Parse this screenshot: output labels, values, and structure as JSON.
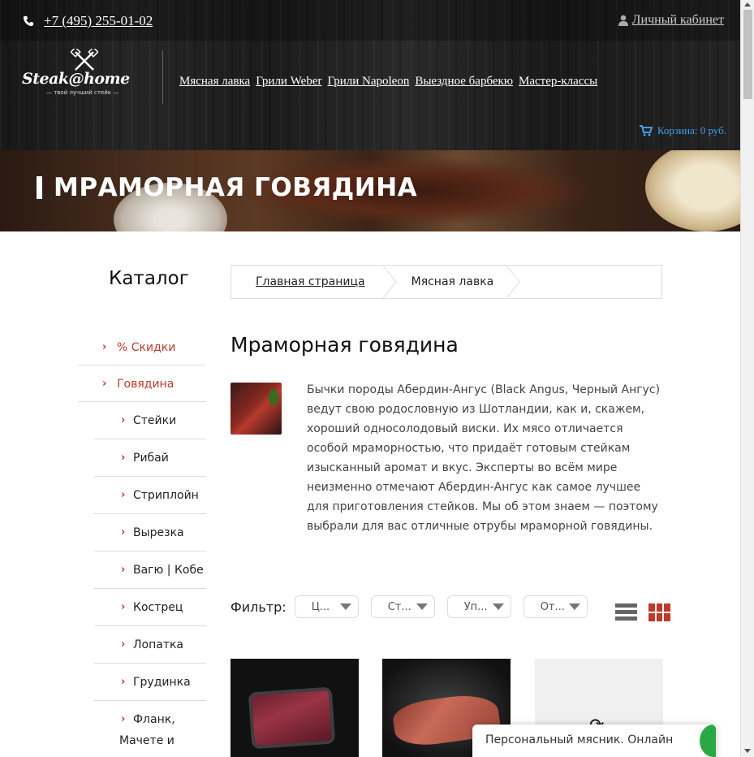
{
  "header": {
    "phone": "+7 (495) 255-01-02",
    "account_label": "Личный кабинет",
    "logo": {
      "brand": "Steak@home",
      "tagline": "— твой лучший стейк —"
    },
    "nav": [
      "Мясная лавка",
      "Грили Weber",
      "Грили Napoleon",
      "Выездное барбекю",
      "Мастер-классы"
    ],
    "cart_label": "Корзина: 0 руб."
  },
  "banner": {
    "title": "МРАМОРНАЯ ГОВЯДИНА"
  },
  "sidebar": {
    "title": "Каталог",
    "top_items": [
      "% Скидки",
      "Говядина"
    ],
    "sub_items": [
      "Стейки",
      "Рибай",
      "Стриплойн",
      "Вырезка",
      "Вагю | Кобе",
      "Кострец",
      "Лопатка",
      "Грудинка",
      "Фланк, Мачете и"
    ]
  },
  "breadcrumb": [
    "Главная страница",
    "Мясная лавка"
  ],
  "main": {
    "title": "Мраморная говядина",
    "description": "Бычки породы Абердин-Ангус (Black Angus, Черный Ангус) ведут свою родословную из Шотландии, как и, скажем, хороший односолодовый виски. Их мясо отличается особой мраморностью, что придаёт готовым стейкам изысканный аромат и вкус. Эксперты во всём мире неизменно отмечают Абердин-Ангус как самое лучшее для приготовления стейков. Мы об этом знаем — поэтому выбрали для вас отличные отрубы мраморной говядины."
  },
  "filter": {
    "label": "Фильтр:",
    "selects": [
      "Ц...",
      "Ст...",
      "Уп...",
      "От..."
    ]
  },
  "chat": {
    "label": "Персональный мясник. Онлайн"
  },
  "colors": {
    "accent": "#c0392b",
    "cart": "#3ea0e8",
    "chat_status": "#2aa845"
  },
  "icons": [
    "phone-icon",
    "user-icon",
    "cart-icon",
    "list-view-icon",
    "grid-view-icon",
    "spinner-icon"
  ]
}
